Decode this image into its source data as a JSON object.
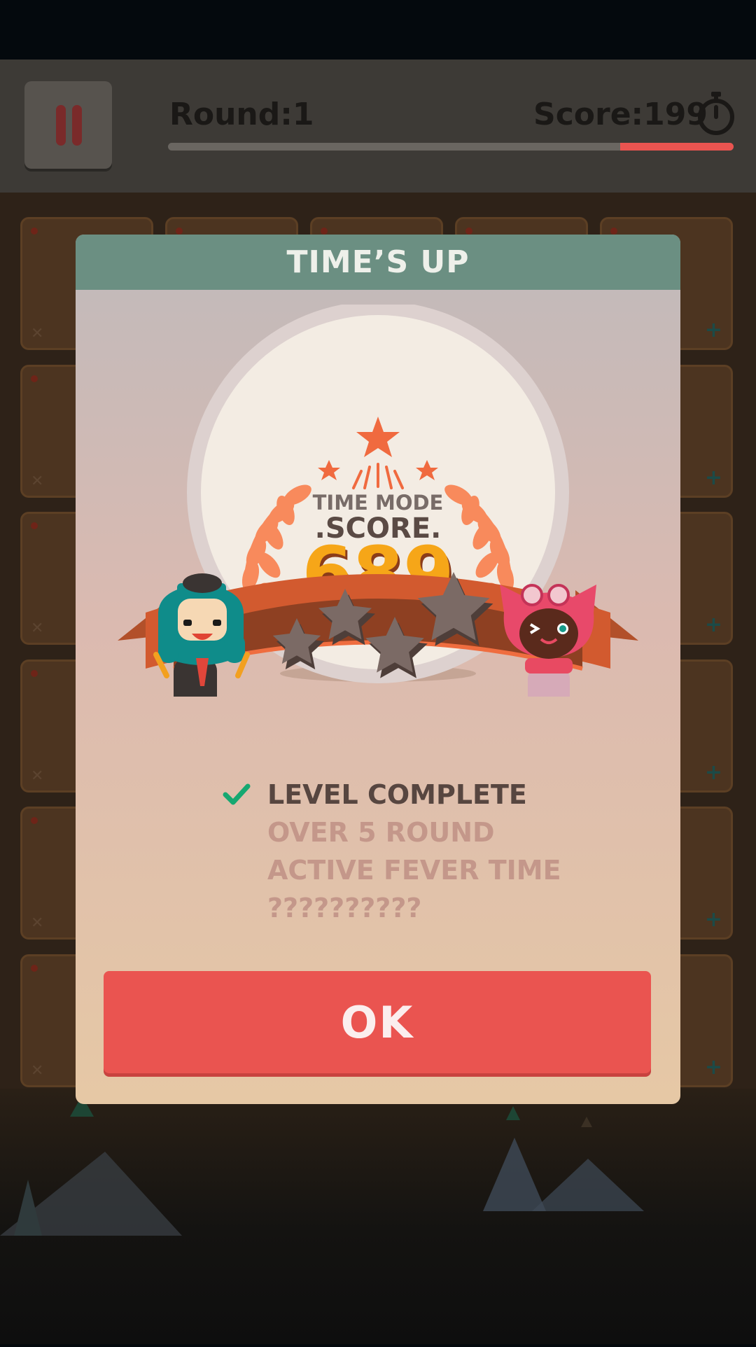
{
  "game": {
    "round_text": "Round:1",
    "score_text": "Score:199",
    "timer_remaining": 0.2,
    "accent": "#ea5450",
    "board": {
      "rows": 6,
      "cols": 5
    }
  },
  "modal": {
    "title": "TIME’S UP",
    "badge": {
      "mode": "TIME MODE",
      "score_label": ".SCORE.",
      "score": "689",
      "stars_earned": 0,
      "stars_total": 4
    },
    "conditions": [
      {
        "text": "LEVEL COMPLETE",
        "done": true
      },
      {
        "text": "OVER 5 ROUND",
        "done": false
      },
      {
        "text": "ACTIVE FEVER TIME",
        "done": false
      },
      {
        "text": "??????????",
        "done": false
      }
    ],
    "ok_label": "OK"
  },
  "colors": {
    "header": "#6b8f82",
    "score": "#f6a618",
    "condition_done": "#574640",
    "condition_pending": "#c4978a",
    "check": "#16a871"
  }
}
